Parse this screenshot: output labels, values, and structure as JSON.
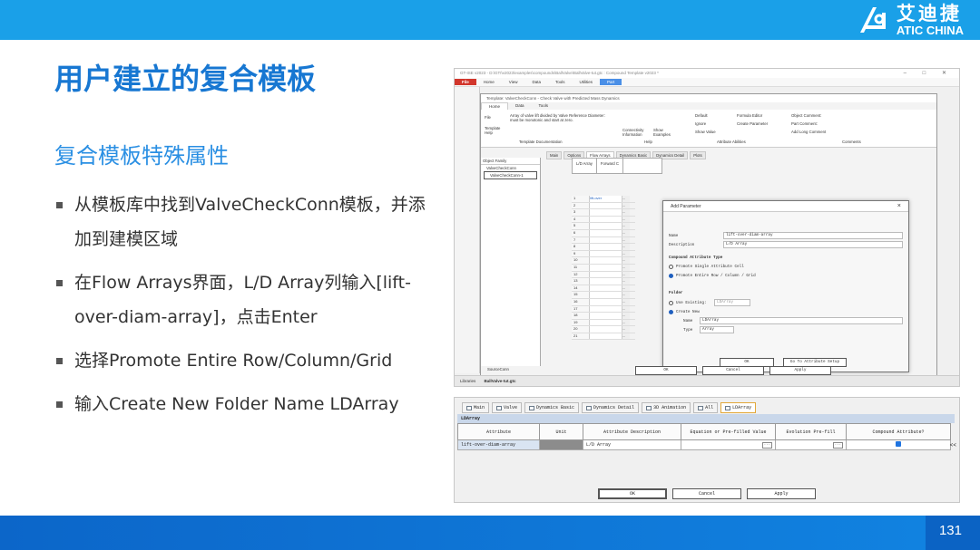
{
  "brand": {
    "name_cn": "艾迪捷",
    "name_en": "ATIC CHINA"
  },
  "slide": {
    "title": "用户建立的复合模板",
    "subtitle": "复合模板特殊属性",
    "bullets": [
      "从模板库中找到ValveCheckConn模板，并添加到建模区域",
      "在Flow Arrays界面，L/D Array列输入[lift-over-diam-array]，点击Enter",
      "选择Promote Entire Row/Column/Grid",
      "输入Create New Folder Name LDArray"
    ],
    "page_number": "131"
  },
  "shot1": {
    "window_title": "GT-ISE v2023 - D:\\GTI\\v2023\\examples\\compounds\\BallValve\\BallValve-tut.gtc : Compound Template v2023 *",
    "menu": [
      "File",
      "Home",
      "View",
      "Data",
      "Tools",
      "Utilities",
      "Part"
    ],
    "template_title": "Template: ValveCheckConn - Check Valve with Predicted Mass Dynamics",
    "template_tabs": [
      "Home",
      "Data",
      "Tools"
    ],
    "ribbon": {
      "file": "File",
      "template_help": "Template\nHelp",
      "doc_text": "Array of valve lift divided by Valve Reference Diameter: must be monotonic and start at zero.",
      "template_documentation": "Template Documentation",
      "connectivity": "Connectivity\nInformation",
      "show_examples": "Show\nExamples",
      "help": "Help",
      "default": "Default",
      "ignore": "Ignore",
      "show_value": "Show Value",
      "formula_editor": "Formula Editor",
      "create_parameter": "Create Parameter",
      "attribute_abilities": "Attribute Abilities",
      "object_comment": "Object Comment:",
      "part_comment": "Part Comment:",
      "add_long_comment": "Add Long Comment",
      "comments": "Comments"
    },
    "object_family": "Object Family",
    "tree_items": [
      "ValveCheckConn",
      "ValveCheckConn-1"
    ],
    "obj_tabs": [
      "Main",
      "Options",
      "Flow Arrays",
      "Dynamics Basic",
      "Dynamics Detail",
      "Plots"
    ],
    "grid_headers": [
      "L/D Array",
      "Forward C"
    ],
    "grid_rows": [
      "1",
      "2",
      "3",
      "4",
      "5",
      "6",
      "7",
      "8",
      "9",
      "10",
      "11",
      "12",
      "13",
      "14",
      "15",
      "16",
      "17",
      "18",
      "19",
      "20",
      "21"
    ],
    "grid_first_value": "lift-over",
    "dialog": {
      "title": "Add Parameter",
      "name_label": "Name",
      "name_value": "lift-over-diam-array",
      "desc_label": "Description",
      "desc_value": "L/D Array",
      "type_heading": "Compound Attribute Type",
      "opt_single": "Promote Single Attribute Cell",
      "opt_entire": "Promote Entire Row / Column / Grid",
      "folder_heading": "Folder",
      "use_existing": "Use Existing:",
      "existing_value": "LDArray",
      "create_new": "Create New",
      "new_name_label": "Name",
      "new_name_value": "LDArray",
      "type_label": "Type",
      "type_value": "Array",
      "ok": "OK",
      "go_to": "Go To Attribute Setup"
    },
    "outer_ok": "OK",
    "outer_cancel": "Cancel",
    "outer_apply": "Apply",
    "side_tree_label": "SourceConn",
    "libraries": "Libraries",
    "file_tab": "BallValve-tut.gtc"
  },
  "shot2": {
    "tabs": [
      "Main",
      "Valve",
      "Dynamics Basic",
      "Dynamics Detail",
      "3D Animation",
      "All",
      "LDArray"
    ],
    "band_label": "LDArray",
    "columns": [
      "Attribute",
      "Unit",
      "Attribute Description",
      "Equation or Pre-filled Value",
      "Evolution Pre-fill",
      "Compound Attribute?"
    ],
    "row": {
      "attribute": "lift-over-diam-array",
      "unit": "",
      "description": "L/D Array",
      "equation": "",
      "evolution": ""
    },
    "side_arrow": "<<",
    "ok": "OK",
    "cancel": "Cancel",
    "apply": "Apply"
  },
  "colors": {
    "top_band": "#1aa0e8",
    "title": "#1777d2",
    "bottom_band": "#0b63c4"
  }
}
